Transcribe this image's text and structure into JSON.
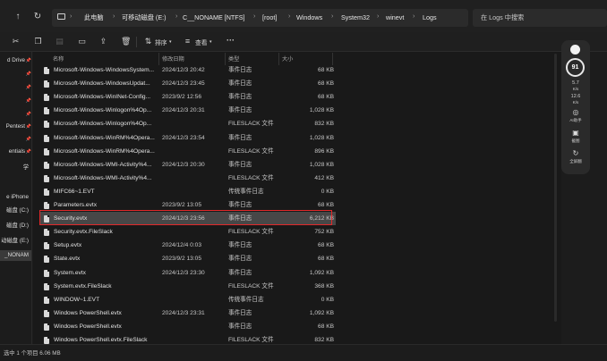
{
  "address": {
    "segments": [
      "此电脑",
      "可移动磁盘 (E:)",
      "C__NONAME [NTFS]",
      "[root]",
      "Windows",
      "System32",
      "winevt",
      "Logs"
    ],
    "search_placeholder": "在 Logs 中搜索"
  },
  "toolbar": {
    "sort_label": "排序",
    "view_label": "查看",
    "more_label": "···"
  },
  "sidebar": {
    "items": [
      {
        "label": "d Drive",
        "pinned": true
      },
      {
        "label": "",
        "pinned": true
      },
      {
        "label": "",
        "pinned": true
      },
      {
        "label": "",
        "pinned": true
      },
      {
        "label": "",
        "pinned": true
      },
      {
        "label": "Pentest",
        "pinned": true
      },
      {
        "label": "",
        "pinned": true
      },
      {
        "label": "entials",
        "pinned": true
      },
      {
        "label": "学",
        "pinned": false
      },
      {
        "label": "",
        "pinned": false
      },
      {
        "label": "e iPhone",
        "pinned": false
      },
      {
        "label": "磁盘 (C:)",
        "pinned": false
      },
      {
        "label": "磁盘 (D:)",
        "pinned": false
      },
      {
        "label": "动磁盘 (E:)",
        "pinned": false
      },
      {
        "label": "_NONAM",
        "pinned": false
      }
    ]
  },
  "columns": {
    "name": "名称",
    "date": "修改日期",
    "type": "类型",
    "size": "大小"
  },
  "files": [
    {
      "name": "Microsoft-Windows-WindowsSystem...",
      "date": "2024/12/3 20:42",
      "type": "事件日志",
      "size": "68 KB"
    },
    {
      "name": "Microsoft-Windows-WindowsUpdat...",
      "date": "2024/12/3 23:45",
      "type": "事件日志",
      "size": "68 KB"
    },
    {
      "name": "Microsoft-Windows-WinINet-Config...",
      "date": "2023/9/2 12:56",
      "type": "事件日志",
      "size": "68 KB"
    },
    {
      "name": "Microsoft-Windows-Winlogon%4Op...",
      "date": "2024/12/3 20:31",
      "type": "事件日志",
      "size": "1,028 KB"
    },
    {
      "name": "Microsoft-Windows-Winlogon%4Op...",
      "date": "",
      "type": "FILESLACK 文件",
      "size": "832 KB"
    },
    {
      "name": "Microsoft-Windows-WinRM%4Opera...",
      "date": "2024/12/3 23:54",
      "type": "事件日志",
      "size": "1,028 KB"
    },
    {
      "name": "Microsoft-Windows-WinRM%4Opera...",
      "date": "",
      "type": "FILESLACK 文件",
      "size": "896 KB"
    },
    {
      "name": "Microsoft-Windows-WMI-Activity%4...",
      "date": "2024/12/3 20:30",
      "type": "事件日志",
      "size": "1,028 KB"
    },
    {
      "name": "Microsoft-Windows-WMI-Activity%4...",
      "date": "",
      "type": "FILESLACK 文件",
      "size": "412 KB"
    },
    {
      "name": "MIFC66~1.EVT",
      "date": "",
      "type": "传统事件日志",
      "size": "0 KB"
    },
    {
      "name": "Parameters.evtx",
      "date": "2023/9/2 13:05",
      "type": "事件日志",
      "size": "68 KB"
    },
    {
      "name": "Security.evtx",
      "date": "2024/12/3 23:56",
      "type": "事件日志",
      "size": "6,212 KB",
      "selected": true
    },
    {
      "name": "Security.evtx.FileSlack",
      "date": "",
      "type": "FILESLACK 文件",
      "size": "752 KB"
    },
    {
      "name": "Setup.evtx",
      "date": "2024/12/4 0:03",
      "type": "事件日志",
      "size": "68 KB"
    },
    {
      "name": "State.evtx",
      "date": "2023/9/2 13:05",
      "type": "事件日志",
      "size": "68 KB"
    },
    {
      "name": "System.evtx",
      "date": "2024/12/3 23:30",
      "type": "事件日志",
      "size": "1,092 KB"
    },
    {
      "name": "System.evtx.FileSlack",
      "date": "",
      "type": "FILESLACK 文件",
      "size": "368 KB"
    },
    {
      "name": "WINDOW~1.EVT",
      "date": "",
      "type": "传统事件日志",
      "size": "0 KB"
    },
    {
      "name": "Windows PowerShell.evtx",
      "date": "2024/12/3 23:31",
      "type": "事件日志",
      "size": "1,092 KB"
    },
    {
      "name": "Windows PowerShell.evtx",
      "date": "",
      "type": "事件日志",
      "size": "68 KB"
    },
    {
      "name": "Windows PowerShell.evtx.FileSlack",
      "date": "",
      "type": "FILESLACK 文件",
      "size": "832 KB"
    }
  ],
  "right_panel": {
    "score": "91",
    "stat1": "5.7",
    "stat1_unit": "K/s",
    "stat2": "12.6",
    "stat2_unit": "K/s",
    "ai_label": "AI助手",
    "shot_label": "截图",
    "full_label": "全屏翻"
  },
  "status": {
    "selection": "选中 1 个项目  6.06 MB"
  },
  "colors": {
    "highlight_box": "#e0292a",
    "selected_row": "#474747"
  }
}
